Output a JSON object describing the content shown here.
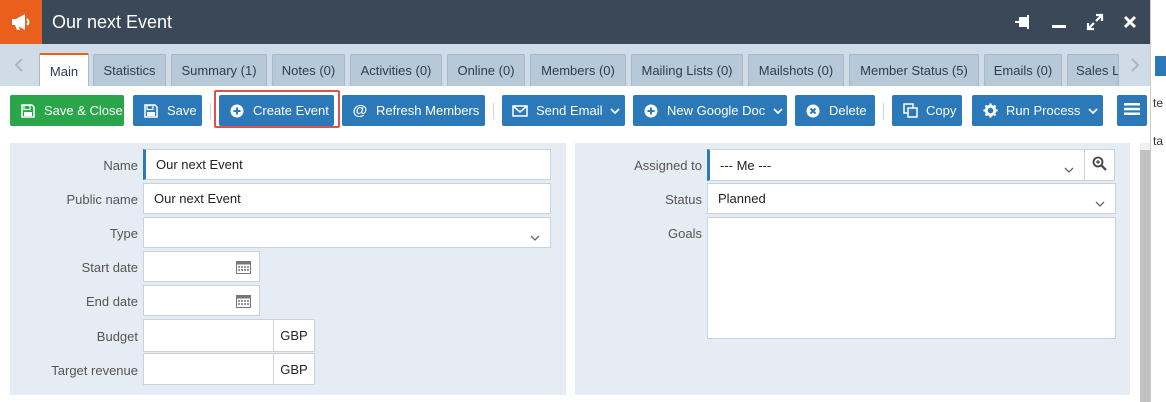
{
  "window": {
    "title": "Our next Event"
  },
  "tabs": [
    {
      "label": "Main"
    },
    {
      "label": "Statistics"
    },
    {
      "label": "Summary (1)"
    },
    {
      "label": "Notes (0)"
    },
    {
      "label": "Activities (0)"
    },
    {
      "label": "Online (0)"
    },
    {
      "label": "Members (0)"
    },
    {
      "label": "Mailing Lists (0)"
    },
    {
      "label": "Mailshots (0)"
    },
    {
      "label": "Member Status (5)"
    },
    {
      "label": "Emails (0)"
    },
    {
      "label": "Sales L"
    }
  ],
  "toolbar": {
    "save_close": "Save & Close",
    "save": "Save",
    "create_event": "Create Event",
    "refresh_members": "Refresh Members",
    "send_email": "Send Email",
    "new_google_doc": "New Google Doc",
    "delete": "Delete",
    "copy": "Copy",
    "run_process": "Run Process"
  },
  "form_left": {
    "name_label": "Name",
    "name_value": "Our next Event",
    "public_name_label": "Public name",
    "public_name_value": "Our next Event",
    "type_label": "Type",
    "type_value": "",
    "start_date_label": "Start date",
    "end_date_label": "End date",
    "budget_label": "Budget",
    "budget_currency": "GBP",
    "target_revenue_label": "Target revenue",
    "target_revenue_currency": "GBP"
  },
  "form_right": {
    "assigned_to_label": "Assigned to",
    "assigned_to_value": "--- Me ---",
    "status_label": "Status",
    "status_value": "Planned",
    "goals_label": "Goals",
    "goals_value": ""
  },
  "edge": {
    "text1": "te",
    "text2": "ta"
  },
  "colors": {
    "brand_orange": "#e8601c",
    "primary_blue": "#2b79b8",
    "success_green": "#2aa54a",
    "titlebar": "#3a4858",
    "highlight_red": "#d9534f"
  }
}
